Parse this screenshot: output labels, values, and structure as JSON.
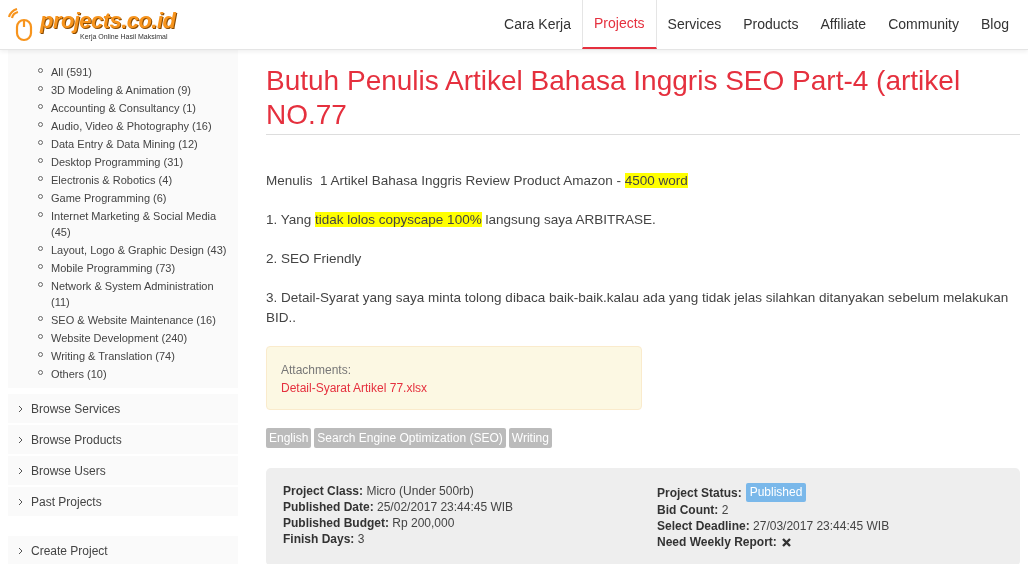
{
  "header": {
    "logo": {
      "name": "projects.co.id",
      "tagline": "Kerja Online Hasil Maksimal"
    },
    "nav": [
      {
        "label": "Cara Kerja",
        "selected": false
      },
      {
        "label": "Projects",
        "selected": true
      },
      {
        "label": "Services",
        "selected": false
      },
      {
        "label": "Products",
        "selected": false
      },
      {
        "label": "Affiliate",
        "selected": false
      },
      {
        "label": "Community",
        "selected": false
      },
      {
        "label": "Blog",
        "selected": false
      }
    ]
  },
  "sidebar": {
    "categories": [
      "All (591)",
      "3D Modeling & Animation (9)",
      "Accounting & Consultancy (1)",
      "Audio, Video & Photography (16)",
      "Data Entry & Data Mining (12)",
      "Desktop Programming (31)",
      "Electronis & Robotics (4)",
      "Game Programming (6)",
      "Internet Marketing & Social Media (45)",
      "Layout, Logo & Graphic Design (43)",
      "Mobile Programming (73)",
      "Network & System Administration (11)",
      "SEO & Website Maintenance (16)",
      "Website Development (240)",
      "Writing & Translation (74)",
      "Others (10)"
    ],
    "links": [
      "Browse Services",
      "Browse Products",
      "Browse Users",
      "Past Projects"
    ],
    "create": "Create Project"
  },
  "project": {
    "title": "Butuh Penulis Artikel Bahasa Inggris SEO Part-4 (artikel NO.77",
    "paragraphs": [
      [
        {
          "text": "Menulis  1 Artikel Bahasa Inggris Review Product Amazon - ",
          "highlight": false
        },
        {
          "text": "4500 word",
          "highlight": true
        }
      ],
      [
        {
          "text": "1. Yang ",
          "highlight": false
        },
        {
          "text": "tidak lolos copyscape 100%",
          "highlight": true
        },
        {
          "text": " langsung saya ARBITRASE.",
          "highlight": false
        }
      ],
      [
        {
          "text": "2. SEO Friendly",
          "highlight": false
        }
      ],
      [
        {
          "text": "3. Detail-Syarat yang saya minta tolong dibaca baik-baik.kalau ada yang tidak jelas silahkan ditanyakan sebelum melakukan BID..",
          "highlight": false
        }
      ]
    ],
    "attachments": {
      "label": "Attachments:",
      "files": [
        "Detail-Syarat Artikel 77.xlsx"
      ]
    },
    "tags": [
      "English",
      "Search Engine Optimization (SEO)",
      "Writing"
    ],
    "info_left": [
      {
        "label": "Project Class:",
        "value": "Micro (Under 500rb)"
      },
      {
        "label": "Published Date:",
        "value": "25/02/2017 23:44:45 WIB"
      },
      {
        "label": "Published Budget:",
        "value": "Rp 200,000"
      },
      {
        "label": "Finish Days:",
        "value": "3"
      }
    ],
    "status": {
      "label": "Project Status:",
      "value": "Published"
    },
    "info_right": [
      {
        "label": "Bid Count:",
        "value": "2"
      },
      {
        "label": "Select Deadline:",
        "value": "27/03/2017 23:44:45 WIB"
      }
    ],
    "weekly_report": {
      "label": "Need Weekly Report:",
      "needed": false
    }
  }
}
